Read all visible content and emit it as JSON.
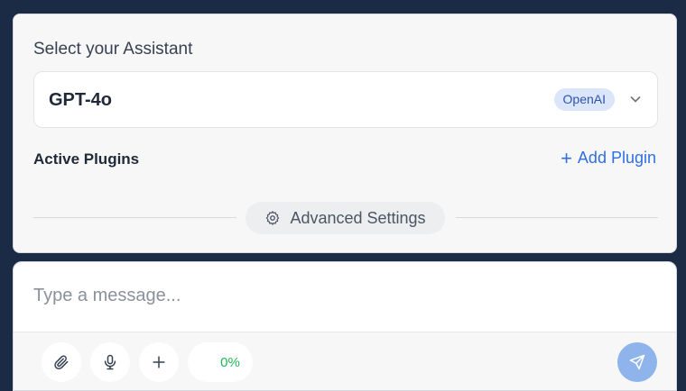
{
  "assistant_panel": {
    "title": "Select your Assistant",
    "selected_model": "GPT-4o",
    "provider_badge": "OpenAI",
    "plugins_label": "Active Plugins",
    "add_plugin_label": "Add Plugin",
    "advanced_settings_label": "Advanced Settings"
  },
  "composer": {
    "value": "",
    "placeholder": "Type a message...",
    "progress_label": "0%",
    "progress_value": 0
  },
  "colors": {
    "background": "#1b2b45",
    "accent": "#2f6fe0",
    "send_button": "#8fb4ec",
    "progress_text": "#22b55a"
  },
  "icons": [
    "chevron-down-icon",
    "plus-icon",
    "gear-icon",
    "paperclip-icon",
    "microphone-icon",
    "plus-icon",
    "send-icon"
  ]
}
